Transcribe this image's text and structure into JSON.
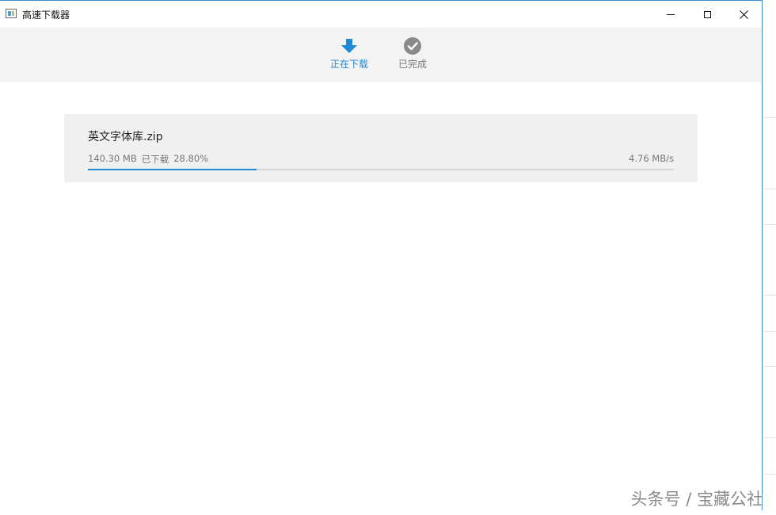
{
  "window": {
    "title": "高速下载器",
    "accent_color": "#3c8fd0"
  },
  "toolbar": {
    "tabs": [
      {
        "label": "正在下载",
        "icon": "download-arrow-icon",
        "active": true,
        "color": "#1e8ad6"
      },
      {
        "label": "已完成",
        "icon": "check-circle-icon",
        "active": false,
        "color": "#7a7a7a"
      }
    ]
  },
  "downloads": [
    {
      "filename": "英文字体库.zip",
      "size": "140.30 MB",
      "status": "已下载",
      "percent_text": "28.80%",
      "progress": 0.288,
      "speed": "4.76 MB/s"
    }
  ],
  "watermark": "头条号 / 宝藏公社"
}
